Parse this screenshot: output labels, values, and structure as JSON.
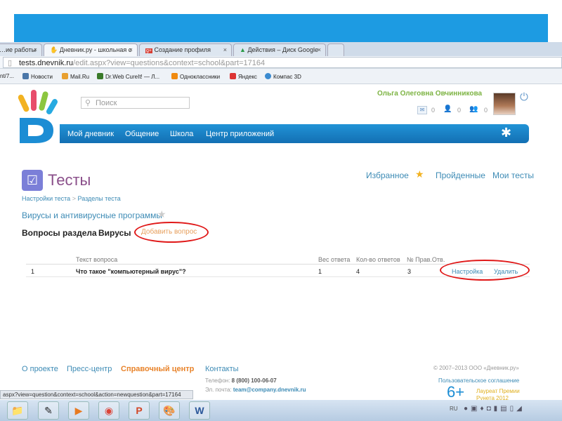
{
  "browser": {
    "tabs": [
      {
        "label": "…ие работы",
        "active": false
      },
      {
        "label": "Дневник.ру - школьная с",
        "active": true
      },
      {
        "label": "Создание профиля",
        "active": false
      },
      {
        "label": "Действия – Диск Google",
        "active": false
      }
    ],
    "url_host": "tests.dnevnik.ru",
    "url_path": "/edit.aspx?view=questions&context=school&part=17164",
    "bookmarks": [
      "nt/7...",
      "Новости",
      "Mail.Ru",
      "Dr.Web CureIt! — Л...",
      "Одноклассники",
      "Яндекс",
      "Компас 3D"
    ],
    "status_url": "aspx?view=question&context=school&action=newquestion&part=17164"
  },
  "header": {
    "search_placeholder": "Поиск",
    "user_name": "Ольга Олеговна Овчинникова",
    "counters": [
      "0",
      "0",
      "0"
    ],
    "nav": [
      "Мой дневник",
      "Общение",
      "Школа",
      "Центр приложений"
    ]
  },
  "page": {
    "title": "Тесты",
    "breadcrumb": [
      "Настройки теста",
      ">",
      "Разделы теста"
    ],
    "top_links": [
      "Избранное",
      "Пройденные",
      "Мои тесты"
    ],
    "test_name": "Вирусы и антивирусные программы",
    "section_label": "Вопросы раздела",
    "section_name": "Вирусы",
    "add_question": "Добавить вопрос",
    "table": {
      "headers": [
        "Текст вопроса",
        "Вес ответа",
        "Кол-во ответов",
        "№ Прав.Отв."
      ],
      "rows": [
        {
          "num": "1",
          "text": "Что такое \"компьютерный вирус\"?",
          "weight": "1",
          "answers": "4",
          "correct": "3",
          "settings": "Настройка",
          "delete": "Удалить"
        }
      ]
    }
  },
  "footer": {
    "links": [
      "О проекте",
      "Пресс-центр",
      "Справочный центр",
      "Контакты"
    ],
    "phone_label": "Телефон:",
    "phone": "8 (800) 100-06-07",
    "email_label": "Эл. почта:",
    "email": "team@company.dnevnik.ru",
    "copyright": "© 2007–2013 ООО «Дневник.ру»",
    "agreement": "Пользовательское соглашение",
    "age": "6+",
    "award": "Лауреат Премии Рунета 2012"
  },
  "taskbar": {
    "lang": "RU"
  }
}
